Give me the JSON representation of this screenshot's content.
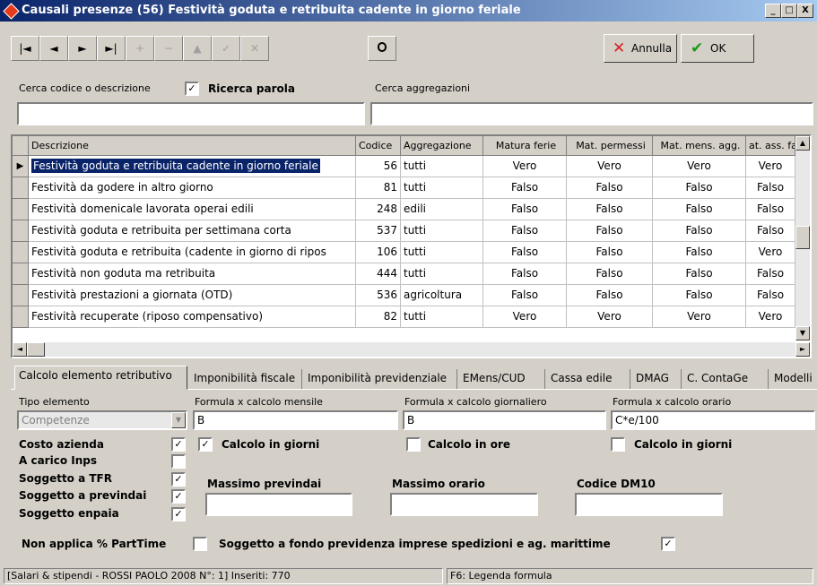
{
  "window": {
    "title": "Causali presenze (56) Festività  goduta e retribuita cadente in giorno feriale",
    "controls": [
      "_",
      "□",
      "X"
    ]
  },
  "toolbar": {
    "nav": [
      "|◄",
      "◄",
      "►",
      "►|",
      "+",
      "−",
      "▲",
      "✓",
      "✕"
    ],
    "lock_icon": "lock-icon",
    "annulla_label": "Annulla",
    "ok_label": "OK",
    "annulla_color": "#d42020",
    "ok_color": "#1a9a1a"
  },
  "search": {
    "code_label": "Cerca codice o descrizione",
    "word_search_label": "Ricerca parola",
    "word_search_checked": true,
    "code_value": "",
    "aggregation_label": "Cerca aggregazioni",
    "aggregation_value": ""
  },
  "grid": {
    "columns": [
      "Descrizione",
      "Codice",
      "Aggregazione",
      "Matura ferie",
      "Mat. permessi",
      "Mat. mens. agg.",
      "at. ass. fa"
    ],
    "rows": [
      {
        "desc": "Festività  goduta e retribuita cadente in giorno feriale",
        "code": "56",
        "agg": "tutti",
        "ferie": "Vero",
        "perm": "Vero",
        "mens": "Vero",
        "ass": "Vero",
        "selected": true
      },
      {
        "desc": "Festività da godere in altro giorno",
        "code": "81",
        "agg": "tutti",
        "ferie": "Falso",
        "perm": "Falso",
        "mens": "Falso",
        "ass": "Falso",
        "selected": false
      },
      {
        "desc": "Festività domenicale lavorata operai edili",
        "code": "248",
        "agg": "edili",
        "ferie": "Falso",
        "perm": "Falso",
        "mens": "Falso",
        "ass": "Falso",
        "selected": false
      },
      {
        "desc": "Festività goduta e retribuita per settimana corta",
        "code": "537",
        "agg": "tutti",
        "ferie": "Falso",
        "perm": "Falso",
        "mens": "Falso",
        "ass": "Falso",
        "selected": false
      },
      {
        "desc": "Festività goduta e retribuita (cadente in giorno di ripos",
        "code": "106",
        "agg": "tutti",
        "ferie": "Falso",
        "perm": "Falso",
        "mens": "Falso",
        "ass": "Vero",
        "selected": false
      },
      {
        "desc": "Festività non goduta ma retribuita",
        "code": "444",
        "agg": "tutti",
        "ferie": "Falso",
        "perm": "Falso",
        "mens": "Falso",
        "ass": "Falso",
        "selected": false
      },
      {
        "desc": "Festività prestazioni a giornata (OTD)",
        "code": "536",
        "agg": "agricoltura",
        "ferie": "Falso",
        "perm": "Falso",
        "mens": "Falso",
        "ass": "Falso",
        "selected": false
      },
      {
        "desc": "Festività recuperate  (riposo compensativo)",
        "code": "82",
        "agg": "tutti",
        "ferie": "Vero",
        "perm": "Vero",
        "mens": "Vero",
        "ass": "Vero",
        "selected": false
      }
    ]
  },
  "tabs": [
    "Calcolo elemento retributivo",
    "Imponibilità fiscale",
    "Imponibilità previdenziale",
    "EMens/CUD",
    "Cassa edile",
    "DMAG",
    "C. ContaGe",
    "Modelli"
  ],
  "form": {
    "tipo_label": "Tipo elemento",
    "tipo_value": "Competenze",
    "mensile_label": "Formula x calcolo mensile",
    "mensile_value": "B",
    "giornaliero_label": "Formula x calcolo giornaliero",
    "giornaliero_value": "B",
    "orario_label": "Formula x calcolo orario",
    "orario_value": "C*e/100",
    "flags": [
      {
        "label": "Costo azienda",
        "checked": true
      },
      {
        "label": "A carico Inps",
        "checked": false
      },
      {
        "label": "Soggetto a TFR",
        "checked": true
      },
      {
        "label": "Soggetto a previndai",
        "checked": true
      },
      {
        "label": "Soggetto enpaia",
        "checked": true
      }
    ],
    "calc_giorni_label": "Calcolo in giorni",
    "calc_giorni_checked": true,
    "calc_ore_label": "Calcolo in ore",
    "calc_ore_checked": false,
    "calc_giorni2_label": "Calcolo in giorni",
    "calc_giorni2_checked": false,
    "massimo_previndai_label": "Massimo previndai",
    "massimo_previndai_value": "",
    "massimo_orario_label": "Massimo orario",
    "massimo_orario_value": "",
    "codice_dm10_label": "Codice DM10",
    "codice_dm10_value": "",
    "parttime_label": "Non applica % PartTime",
    "parttime_checked": false,
    "fondo_label": "Soggetto a fondo previdenza imprese spedizioni e ag. marittime",
    "fondo_checked": true
  },
  "status": {
    "left": "[Salari & stipendi - ROSSI PAOLO 2008 N°: 1]  Inseriti: 770",
    "right": "F6: Legenda formula"
  }
}
